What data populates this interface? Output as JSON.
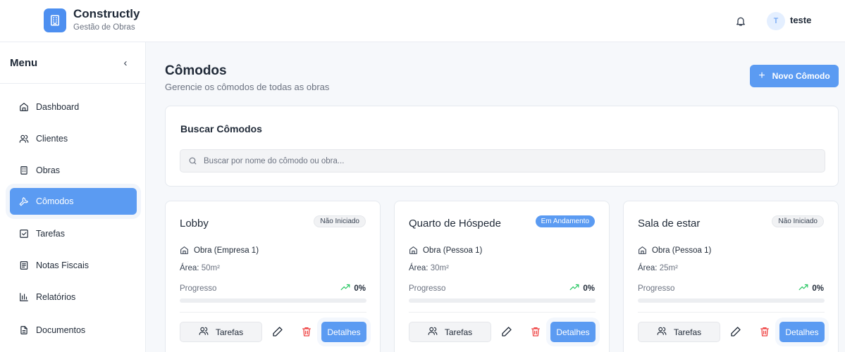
{
  "header": {
    "app_title": "Constructly",
    "app_subtitle": "Gestão de Obras",
    "user_initial": "T",
    "user_name": "teste"
  },
  "sidebar": {
    "menu_title": "Menu",
    "collapse_glyph": "‹",
    "items": [
      {
        "label": "Dashboard",
        "icon": "home-icon",
        "active": false
      },
      {
        "label": "Clientes",
        "icon": "users-icon",
        "active": false
      },
      {
        "label": "Obras",
        "icon": "building-icon",
        "active": false
      },
      {
        "label": "Cômodos",
        "icon": "wrench-icon",
        "active": true
      },
      {
        "label": "Tarefas",
        "icon": "checkbox-icon",
        "active": false
      },
      {
        "label": "Notas Fiscais",
        "icon": "receipt-icon",
        "active": false
      },
      {
        "label": "Relatórios",
        "icon": "bar-chart-icon",
        "active": false
      },
      {
        "label": "Documentos",
        "icon": "document-icon",
        "active": false
      }
    ]
  },
  "main": {
    "title": "Cômodos",
    "subtitle": "Gerencie os cômodos de todas as obras",
    "new_button": "Novo Cômodo",
    "search": {
      "title": "Buscar Cômodos",
      "placeholder": "Buscar por nome do cômodo ou obra..."
    },
    "cards": [
      {
        "name": "Lobby",
        "status": "Não Iniciado",
        "status_kind": "gray",
        "obra": "Obra (Empresa 1)",
        "area_label": "Área:",
        "area": "50m²",
        "progress_label": "Progresso",
        "progress": "0%",
        "progress_value": 0,
        "tasks_label": "Tarefas",
        "details_label": "Detalhes"
      },
      {
        "name": "Quarto de Hóspede",
        "status": "Em Andamento",
        "status_kind": "blue",
        "obra": "Obra (Pessoa 1)",
        "area_label": "Área:",
        "area": "30m²",
        "progress_label": "Progresso",
        "progress": "0%",
        "progress_value": 0,
        "tasks_label": "Tarefas",
        "details_label": "Detalhes"
      },
      {
        "name": "Sala de estar",
        "status": "Não Iniciado",
        "status_kind": "gray",
        "obra": "Obra (Pessoa 1)",
        "area_label": "Área:",
        "area": "25m²",
        "progress_label": "Progresso",
        "progress": "0%",
        "progress_value": 0,
        "tasks_label": "Tarefas",
        "details_label": "Detalhes"
      }
    ]
  },
  "colors": {
    "accent": "#5b9bf2",
    "trend_green": "#22c55e",
    "delete_red": "#ef4444"
  }
}
